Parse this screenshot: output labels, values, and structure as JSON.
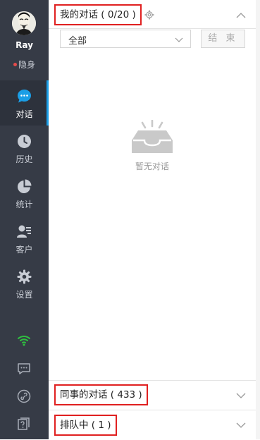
{
  "user": {
    "name": "Ray",
    "status": "隐身"
  },
  "nav": {
    "chat": "对话",
    "history": "历史",
    "stats": "统计",
    "customers": "客户",
    "settings": "设置"
  },
  "my_conversations": {
    "title": "我的对话 ( 0/20 )",
    "filter_value": "全部",
    "end_button": "结 束",
    "empty_text": "暂无对话"
  },
  "colleague_conversations": {
    "title": "同事的对话 ( 433 )"
  },
  "queue": {
    "title": "排队中 ( 1 )"
  },
  "colors": {
    "sidebar_bg": "#363b46",
    "active_accent": "#1a9ee6",
    "highlight_border": "#e02020",
    "wifi_green": "#2fbf40",
    "status_dot": "#e64b4b"
  },
  "icons": [
    "avatar",
    "chat-icon",
    "history-clock-icon",
    "pie-chart-icon",
    "customer-icon",
    "gear-icon",
    "wifi-icon",
    "message-icon",
    "link-icon",
    "help-icon",
    "settings-small-icon",
    "chevron-up-icon",
    "chevron-down-icon",
    "empty-inbox-icon"
  ]
}
